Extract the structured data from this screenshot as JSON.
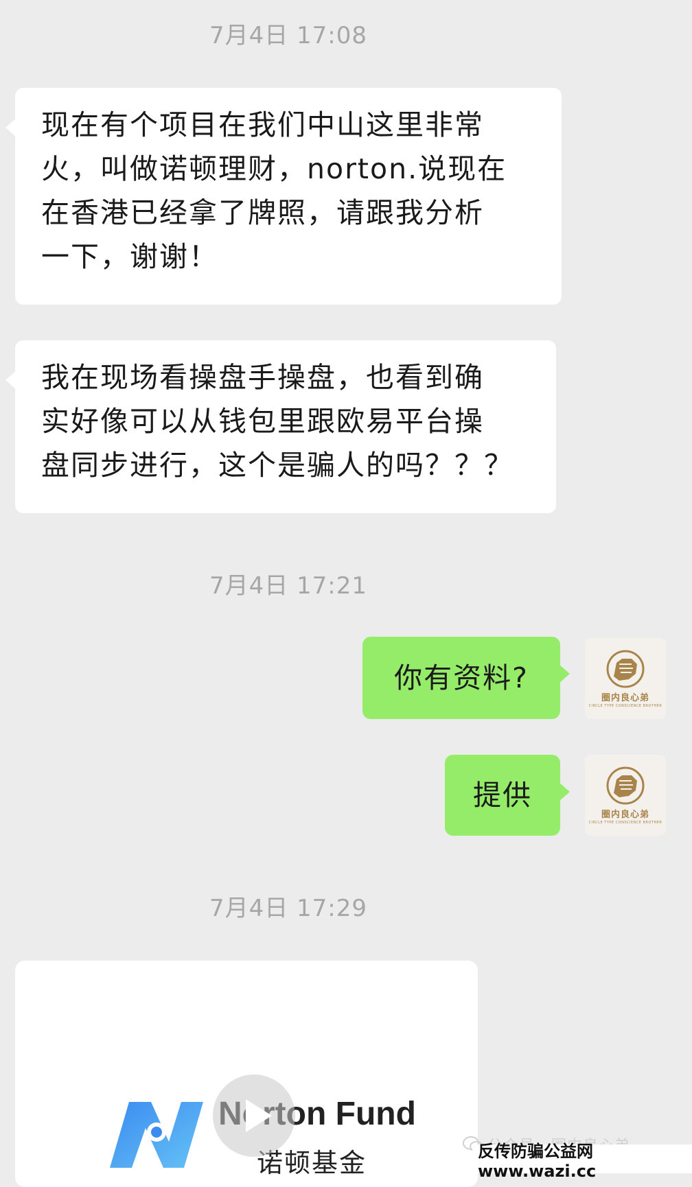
{
  "timestamps": [
    "7月4日 17:08",
    "7月4日 17:21",
    "7月4日 17:29"
  ],
  "messages": [
    {
      "side": "incoming",
      "lines": [
        "现在有个项目在我们中山这里非常",
        "火，叫做诺顿理财，norton.说现在",
        "在香港已经拿了牌照，请跟我分析",
        "一下，谢谢！"
      ]
    },
    {
      "side": "incoming",
      "lines": [
        "我在现场看操盘手操盘，也看到确",
        "实好像可以从钱包里跟欧易平台操",
        "盘同步进行，这个是骗人的吗？？？"
      ]
    },
    {
      "side": "outgoing",
      "text": "你有资料?"
    },
    {
      "side": "outgoing",
      "text": "提供"
    }
  ],
  "avatar": {
    "name": "圈内良心弟",
    "subtitle": "CIRCLE TYPE CONSCIENCE BROTHER"
  },
  "video_card": {
    "brand_title": "Norton Fund",
    "brand_subtitle": "诺顿基金"
  },
  "watermark": {
    "account": "公众号 · 圈内良心弟",
    "site": "反传防骗公益网 www.wazi.cc"
  },
  "colors": {
    "background": "#ececec",
    "incoming_bubble": "#ffffff",
    "outgoing_bubble": "#95ec69",
    "timestamp": "#a6a6a6",
    "brand_gold": "#a8844a"
  }
}
